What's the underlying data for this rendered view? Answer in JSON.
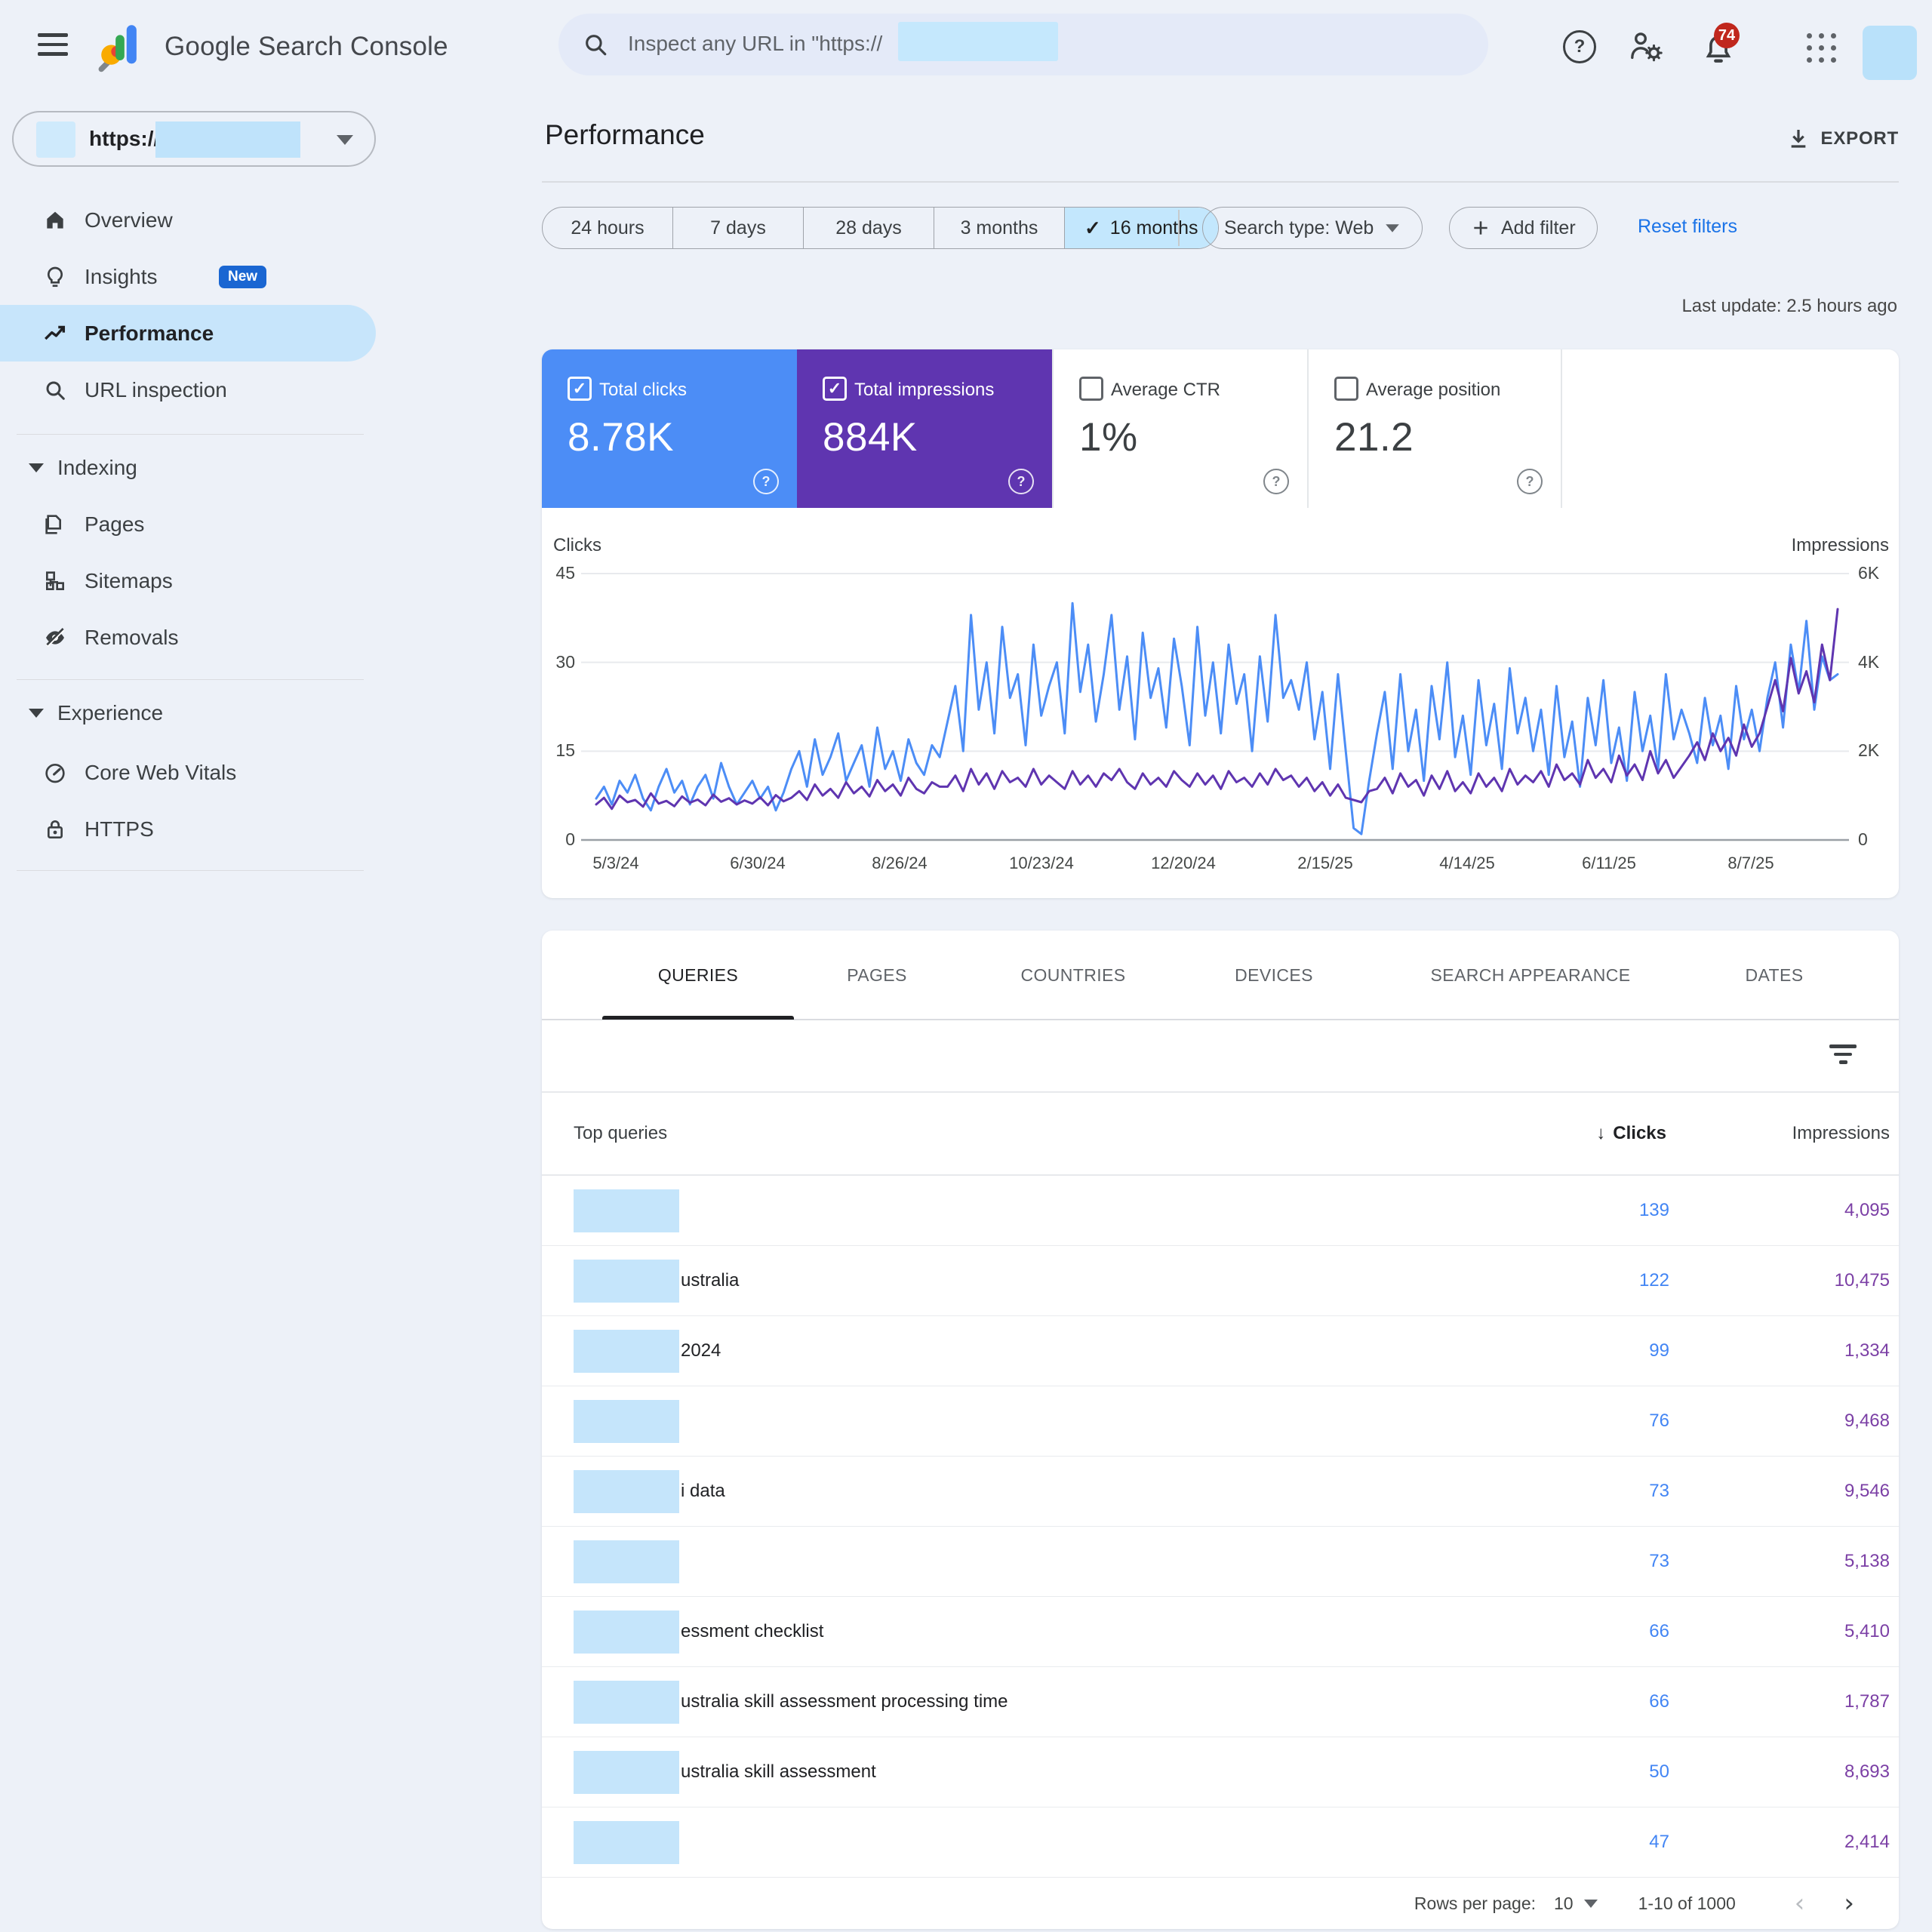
{
  "colors": {
    "clicks": "#4c8df6",
    "impressions": "#5f35b0",
    "clicks_number": "#4285f4",
    "impressions_number": "#7b3fa5",
    "link_blue": "#1a73e8",
    "badge_red": "#c0271d",
    "selected_nav_bg": "#c7e5fb",
    "selected_segment_bg": "#c3e7fd",
    "redaction_blue": "#c5e5fb"
  },
  "header": {
    "app_title": "Google Search Console",
    "search_placeholder": "Inspect any URL in \"https://",
    "notification_count": "74"
  },
  "sidebar": {
    "property": {
      "scheme_text": "https://"
    },
    "items": [
      {
        "label": "Overview"
      },
      {
        "label": "Insights",
        "badge": "New"
      },
      {
        "label": "Performance"
      },
      {
        "label": "URL inspection"
      }
    ],
    "sections": [
      {
        "label": "Indexing",
        "items": [
          "Pages",
          "Sitemaps",
          "Removals"
        ]
      },
      {
        "label": "Experience",
        "items": [
          "Core Web Vitals",
          "HTTPS"
        ]
      }
    ]
  },
  "page": {
    "title": "Performance",
    "export_label": "EXPORT",
    "last_update": "Last update: 2.5 hours ago",
    "date_ranges": [
      "24 hours",
      "7 days",
      "28 days",
      "3 months",
      "16 months"
    ],
    "selected_range": "16 months",
    "search_type_label": "Search type: Web",
    "add_filter_label": "Add filter",
    "reset_filters_label": "Reset filters",
    "help_glyph": "?"
  },
  "metrics": [
    {
      "label": "Total clicks",
      "value": "8.78K",
      "checked": true,
      "color": "#4c8df6"
    },
    {
      "label": "Total impressions",
      "value": "884K",
      "checked": true,
      "color": "#5f35b0"
    },
    {
      "label": "Average CTR",
      "value": "1%",
      "checked": false,
      "color": ""
    },
    {
      "label": "Average position",
      "value": "21.2",
      "checked": false,
      "color": ""
    }
  ],
  "chart_data": {
    "type": "line",
    "title": "",
    "grid": true,
    "legend_position": "none",
    "y_axis_left": {
      "title": "Clicks",
      "ticks": [
        "45",
        "30",
        "15",
        "0"
      ],
      "max": 45
    },
    "y_axis_right": {
      "title": "Impressions",
      "ticks": [
        "6K",
        "4K",
        "2K",
        "0"
      ],
      "max": 6000
    },
    "x_labels": [
      "5/3/24",
      "6/30/24",
      "8/26/24",
      "10/23/24",
      "12/20/24",
      "2/15/25",
      "4/14/25",
      "6/11/25",
      "8/7/25"
    ],
    "series": [
      {
        "name": "Total clicks",
        "axis": "left",
        "color": "#4c8df6",
        "values": [
          7,
          9,
          6,
          10,
          8,
          11,
          7,
          5,
          9,
          12,
          8,
          10,
          6,
          9,
          11,
          7,
          13,
          9,
          6,
          8,
          10,
          7,
          9,
          5,
          8,
          12,
          15,
          9,
          17,
          11,
          14,
          18,
          10,
          13,
          16,
          9,
          19,
          12,
          15,
          10,
          17,
          13,
          11,
          16,
          14,
          20,
          26,
          15,
          38,
          22,
          30,
          18,
          36,
          24,
          28,
          16,
          33,
          21,
          26,
          30,
          18,
          40,
          25,
          33,
          20,
          28,
          38,
          22,
          31,
          17,
          35,
          24,
          29,
          19,
          34,
          26,
          16,
          36,
          21,
          30,
          18,
          33,
          23,
          28,
          15,
          31,
          20,
          38,
          24,
          27,
          22,
          30,
          17,
          25,
          12,
          28,
          15,
          2,
          1,
          10,
          18,
          25,
          12,
          28,
          15,
          22,
          10,
          26,
          17,
          30,
          14,
          21,
          11,
          27,
          16,
          23,
          12,
          29,
          18,
          24,
          15,
          22,
          11,
          26,
          14,
          20,
          9,
          24,
          16,
          27,
          13,
          19,
          10,
          25,
          15,
          21,
          12,
          28,
          17,
          22,
          18,
          13,
          24,
          16,
          21,
          12,
          26,
          17,
          22,
          15,
          24,
          30,
          19,
          33,
          25,
          37,
          22,
          31,
          27,
          28
        ]
      },
      {
        "name": "Total impressions",
        "axis": "right",
        "color": "#5f35b0",
        "values": [
          800,
          950,
          700,
          1000,
          850,
          900,
          750,
          1050,
          820,
          880,
          760,
          980,
          840,
          910,
          780,
          1020,
          860,
          940,
          800,
          890,
          820,
          960,
          780,
          1010,
          870,
          950,
          1100,
          900,
          1250,
          1000,
          1150,
          950,
          1300,
          1050,
          1200,
          980,
          1350,
          1100,
          1250,
          1000,
          1400,
          1150,
          1050,
          1300,
          1200,
          1200,
          1450,
          1100,
          1600,
          1250,
          1500,
          1150,
          1550,
          1300,
          1400,
          1200,
          1600,
          1250,
          1450,
          1300,
          1150,
          1550,
          1250,
          1450,
          1200,
          1500,
          1350,
          1600,
          1300,
          1150,
          1500,
          1250,
          1400,
          1200,
          1550,
          1350,
          1200,
          1500,
          1250,
          1450,
          1150,
          1550,
          1300,
          1400,
          1200,
          1500,
          1250,
          1600,
          1350,
          1450,
          1200,
          1400,
          1100,
          1300,
          1000,
          1250,
          950,
          900,
          850,
          1100,
          1150,
          1400,
          1050,
          1500,
          1200,
          1350,
          1000,
          1450,
          1150,
          1550,
          1100,
          1300,
          1050,
          1500,
          1200,
          1400,
          1100,
          1600,
          1250,
          1450,
          1300,
          1550,
          1200,
          1700,
          1350,
          1500,
          1250,
          1800,
          1400,
          1600,
          1300,
          1900,
          1450,
          1700,
          1350,
          2000,
          1500,
          1800,
          1400,
          1650,
          1900,
          2200,
          1800,
          2400,
          2000,
          2300,
          1900,
          2600,
          2100,
          2400,
          3000,
          3600,
          2900,
          4100,
          3300,
          3800,
          3100,
          4400,
          3600,
          5200
        ]
      }
    ]
  },
  "table": {
    "tabs": [
      "QUERIES",
      "PAGES",
      "COUNTRIES",
      "DEVICES",
      "SEARCH APPEARANCE",
      "DATES"
    ],
    "active_tab": "QUERIES",
    "header": {
      "dimension": "Top queries",
      "clicks": "Clicks",
      "impressions": "Impressions",
      "sort_arrow": "↓"
    },
    "rows": [
      {
        "query_visible": "",
        "clicks": "139",
        "impressions": "4,095"
      },
      {
        "query_visible": "ustralia",
        "clicks": "122",
        "impressions": "10,475"
      },
      {
        "query_visible": "2024",
        "clicks": "99",
        "impressions": "1,334"
      },
      {
        "query_visible": "",
        "clicks": "76",
        "impressions": "9,468"
      },
      {
        "query_visible": "i data",
        "clicks": "73",
        "impressions": "9,546"
      },
      {
        "query_visible": "",
        "clicks": "73",
        "impressions": "5,138"
      },
      {
        "query_visible": "essment checklist",
        "clicks": "66",
        "impressions": "5,410"
      },
      {
        "query_visible": "ustralia skill assessment processing time",
        "clicks": "66",
        "impressions": "1,787"
      },
      {
        "query_visible": "ustralia skill assessment",
        "clicks": "50",
        "impressions": "8,693"
      },
      {
        "query_visible": "",
        "clicks": "47",
        "impressions": "2,414"
      }
    ],
    "footer": {
      "rows_per_page_label": "Rows per page:",
      "rows_per_page": "10",
      "range": "1-10 of 1000",
      "prev_glyph": "‹",
      "next_glyph": "›"
    }
  }
}
